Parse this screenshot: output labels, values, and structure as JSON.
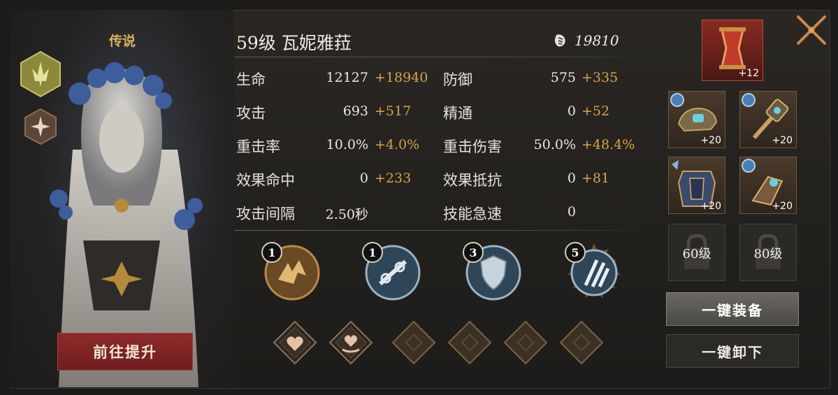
{
  "hero": {
    "rarity": "传说",
    "name": "59级 瓦妮雅菈",
    "power": "19810",
    "promote_label": "前往提升"
  },
  "stats": [
    {
      "label": "生命",
      "base": "12127",
      "bonus": "+18940"
    },
    {
      "label": "防御",
      "base": "575",
      "bonus": "+335"
    },
    {
      "label": "攻击",
      "base": "693",
      "bonus": "+517"
    },
    {
      "label": "精通",
      "base": "0",
      "bonus": "+52"
    },
    {
      "label": "重击率",
      "base": "10.0%",
      "bonus": "+4.0%"
    },
    {
      "label": "重击伤害",
      "base": "50.0%",
      "bonus": "+48.4%"
    },
    {
      "label": "效果命中",
      "base": "0",
      "bonus": "+233"
    },
    {
      "label": "效果抵抗",
      "base": "0",
      "bonus": "+81"
    },
    {
      "label": "攻击间隔",
      "base": "2.50秒",
      "bonus": ""
    },
    {
      "label": "技能急速",
      "base": "0",
      "bonus": ""
    }
  ],
  "skills": [
    {
      "level": "1",
      "icon": "wolf-claw-icon"
    },
    {
      "level": "1",
      "icon": "chain-icon"
    },
    {
      "level": "3",
      "icon": "shield-icon"
    },
    {
      "level": "5",
      "icon": "triple-slash-icon"
    }
  ],
  "runes": [
    {
      "icon": "heart-icon",
      "state": "filled"
    },
    {
      "icon": "heart-hand-icon",
      "state": "filled"
    },
    {
      "icon": "empty-rune-icon",
      "state": "empty"
    },
    {
      "icon": "empty-rune-icon",
      "state": "empty"
    },
    {
      "icon": "empty-rune-icon",
      "state": "empty"
    },
    {
      "icon": "empty-rune-icon",
      "state": "empty"
    }
  ],
  "equipment": {
    "top": {
      "level": "+12",
      "icon": "hourglass-icon"
    },
    "items": [
      {
        "level": "+20",
        "icon": "helmet-icon"
      },
      {
        "level": "+20",
        "icon": "hammer-icon"
      },
      {
        "level": "+20",
        "icon": "armor-icon"
      },
      {
        "level": "+20",
        "icon": "gauntlet-icon"
      }
    ],
    "locked": [
      {
        "label": "60级"
      },
      {
        "label": "80级"
      }
    ]
  },
  "actions": {
    "equip_all": "一键装备",
    "unequip_all": "一键卸下"
  },
  "colors": {
    "bonus": "#d7a44a",
    "promote": "#8e2a2b",
    "accent_gold": "#d9b25e"
  }
}
